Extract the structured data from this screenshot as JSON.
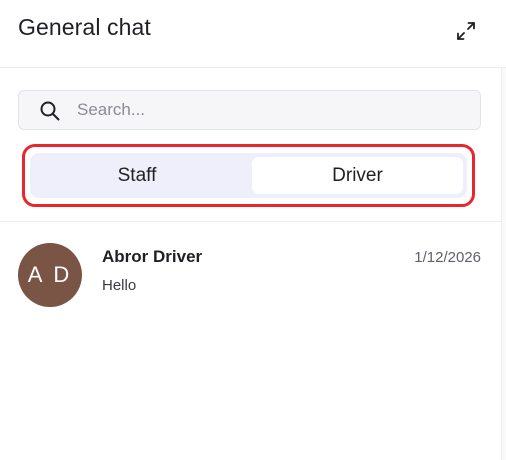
{
  "panel": {
    "title": "General chat",
    "expand_icon": "expand-arrows-icon"
  },
  "search": {
    "placeholder": "Search...",
    "value": "",
    "icon": "search-icon"
  },
  "tabs": [
    {
      "label": "Staff",
      "selected": false
    },
    {
      "label": "Driver",
      "selected": true
    }
  ],
  "highlight_color": "#e8262b",
  "chats": [
    {
      "initials": "A D",
      "name": "Abror Driver",
      "date": "1/12/2026",
      "preview": "Hello",
      "avatar_color": "#7a5444"
    }
  ]
}
